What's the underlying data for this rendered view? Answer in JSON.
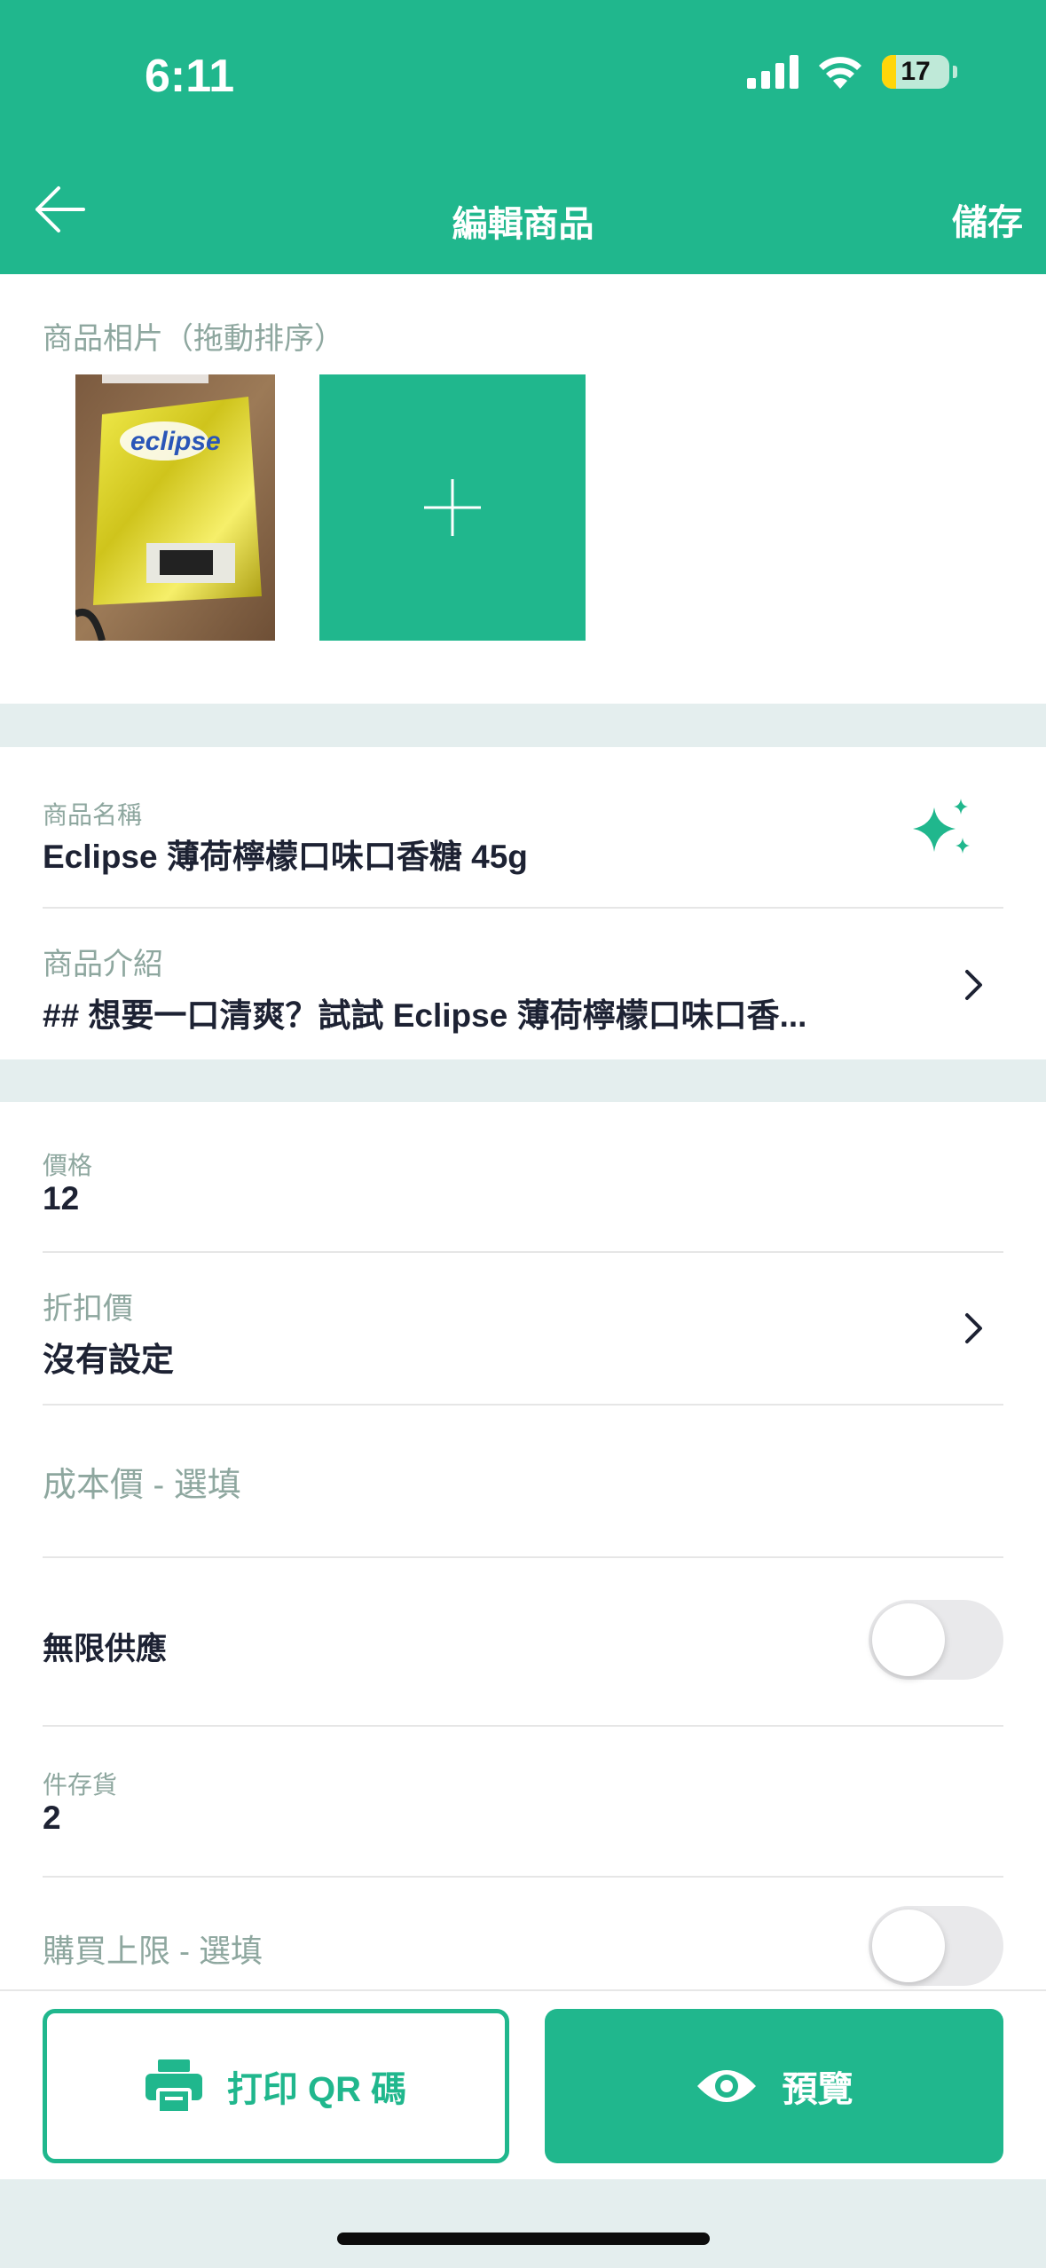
{
  "status_bar": {
    "time": "6:11",
    "battery": "17"
  },
  "header": {
    "title": "編輯商品",
    "save_label": "儲存"
  },
  "photos": {
    "section_label": "商品相片（拖動排序）"
  },
  "fields": {
    "name": {
      "label": "商品名稱",
      "value": "Eclipse 薄荷檸檬口味口香糖 45g"
    },
    "description": {
      "label": "商品介紹",
      "value": "## 想要一口清爽？試試 Eclipse 薄荷檸檬口味口香..."
    },
    "price": {
      "label": "價格",
      "value": "12"
    },
    "discount": {
      "label": "折扣價",
      "value": "沒有設定"
    },
    "cost": {
      "placeholder": "成本價 - 選填"
    },
    "unlimited": {
      "label": "無限供應",
      "on": false
    },
    "stock": {
      "label": "件存貨",
      "value": "2"
    },
    "limit": {
      "label": "購買上限 - 選填",
      "on": false
    }
  },
  "actions": {
    "print_label": "打印 QR 碼",
    "preview_label": "預覽"
  },
  "colors": {
    "brand": "#20b78d",
    "muted_text": "#8ea79f",
    "dark_text": "#1d2233"
  }
}
